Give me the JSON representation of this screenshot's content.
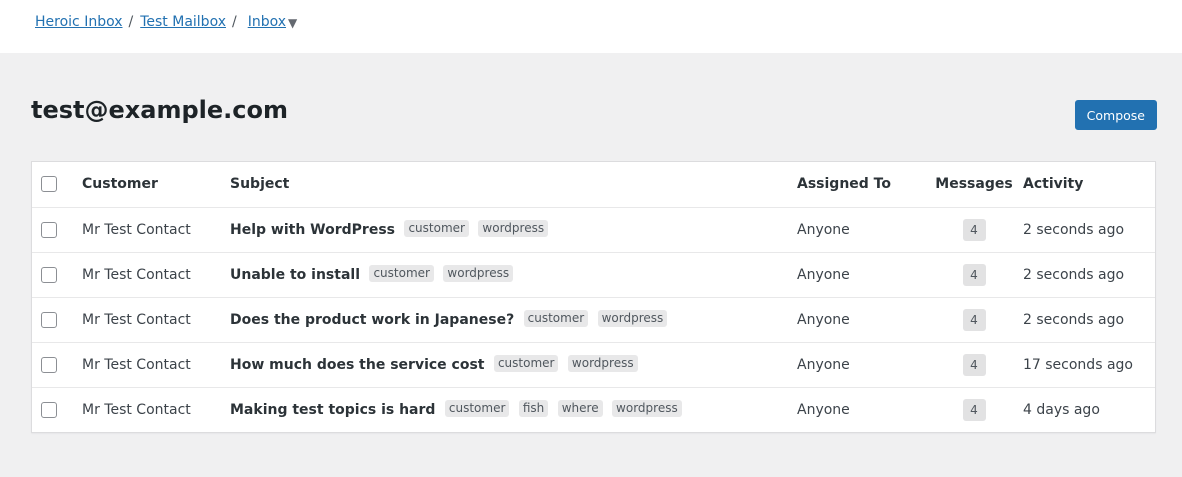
{
  "breadcrumb": {
    "items": [
      {
        "label": "Heroic Inbox"
      },
      {
        "label": "Test Mailbox"
      }
    ],
    "separator": "/",
    "current": "Inbox",
    "caret": "▼"
  },
  "page": {
    "title": "test@example.com",
    "compose_label": "Compose"
  },
  "table": {
    "headers": {
      "customer": "Customer",
      "subject": "Subject",
      "assigned": "Assigned To",
      "messages": "Messages",
      "activity": "Activity"
    },
    "rows": [
      {
        "customer": "Mr Test Contact",
        "subject": "Help with WordPress",
        "tags": [
          "customer",
          "wordpress"
        ],
        "assigned": "Anyone",
        "messages": "4",
        "activity": "2 seconds ago"
      },
      {
        "customer": "Mr Test Contact",
        "subject": "Unable to install",
        "tags": [
          "customer",
          "wordpress"
        ],
        "assigned": "Anyone",
        "messages": "4",
        "activity": "2 seconds ago"
      },
      {
        "customer": "Mr Test Contact",
        "subject": "Does the product work in Japanese?",
        "tags": [
          "customer",
          "wordpress"
        ],
        "assigned": "Anyone",
        "messages": "4",
        "activity": "2 seconds ago"
      },
      {
        "customer": "Mr Test Contact",
        "subject": "How much does the service cost",
        "tags": [
          "customer",
          "wordpress"
        ],
        "assigned": "Anyone",
        "messages": "4",
        "activity": "17 seconds ago"
      },
      {
        "customer": "Mr Test Contact",
        "subject": "Making test topics is hard",
        "tags": [
          "customer",
          "fish",
          "where",
          "wordpress"
        ],
        "assigned": "Anyone",
        "messages": "4",
        "activity": "4 days ago"
      }
    ]
  },
  "colors": {
    "accent": "#2271b1",
    "background": "#f0f0f1",
    "tag_bg": "#e8e8e9"
  }
}
